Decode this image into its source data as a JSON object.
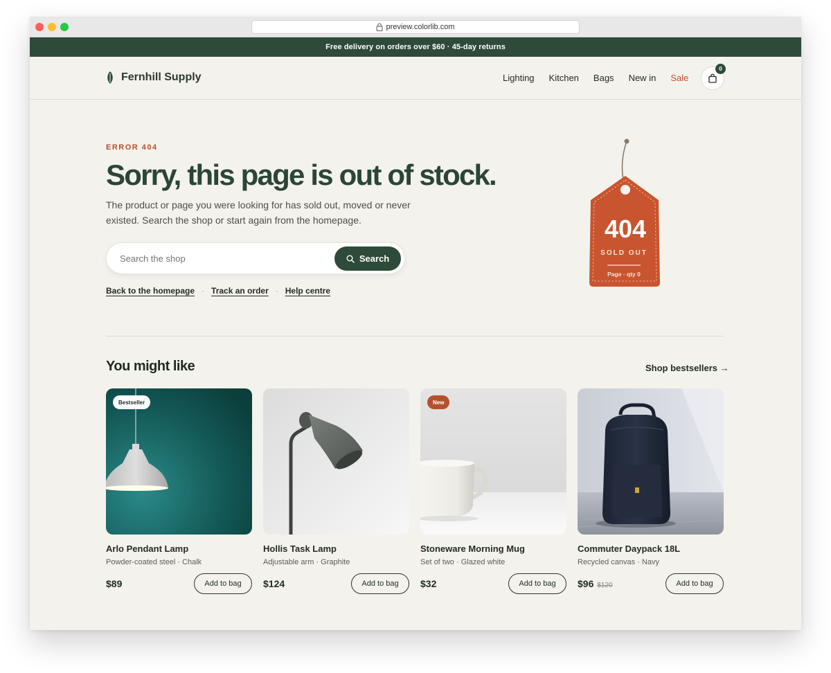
{
  "browser": {
    "url": "preview.colorlib.com"
  },
  "promo": {
    "text": "Free delivery on orders over $60 · 45-day returns"
  },
  "header": {
    "brand": "Fernhill Supply",
    "nav": [
      "Lighting",
      "Kitchen",
      "Bags",
      "New in",
      "Sale"
    ],
    "cart_count": "0"
  },
  "hero": {
    "eyebrow": "ERROR 404",
    "headline": "Sorry, this page is out of stock.",
    "subtext": "The product or page you were looking for has sold out, moved or never existed. Search the shop or start again from the homepage.",
    "search_placeholder": "Search the shop",
    "search_button": "Search",
    "links": [
      "Back to the homepage",
      "Track an order",
      "Help centre"
    ],
    "separator": "·"
  },
  "tag": {
    "code": "404",
    "status": "SOLD OUT",
    "note": "Page · qty 0"
  },
  "recommend": {
    "title": "You might like",
    "link": "Shop bestsellers →",
    "products": [
      {
        "name": "Arlo Pendant Lamp",
        "desc": "Powder-coated steel · Chalk",
        "price": "$89",
        "old_price": "",
        "badge": "Bestseller",
        "button": "Add to bag"
      },
      {
        "name": "Hollis Task Lamp",
        "desc": "Adjustable arm · Graphite",
        "price": "$124",
        "old_price": "",
        "badge": "",
        "button": "Add to bag"
      },
      {
        "name": "Stoneware Morning Mug",
        "desc": "Set of two · Glazed white",
        "price": "$32",
        "old_price": "",
        "badge": "New",
        "button": "Add to bag"
      },
      {
        "name": "Commuter Daypack 18L",
        "desc": "Recycled canvas · Navy",
        "price": "$96",
        "old_price": "$120",
        "badge": "",
        "button": "Add to bag"
      }
    ]
  },
  "colors": {
    "brand_green": "#2e4a39",
    "accent_orange": "#c0512b",
    "background": "#f4f2ec"
  }
}
